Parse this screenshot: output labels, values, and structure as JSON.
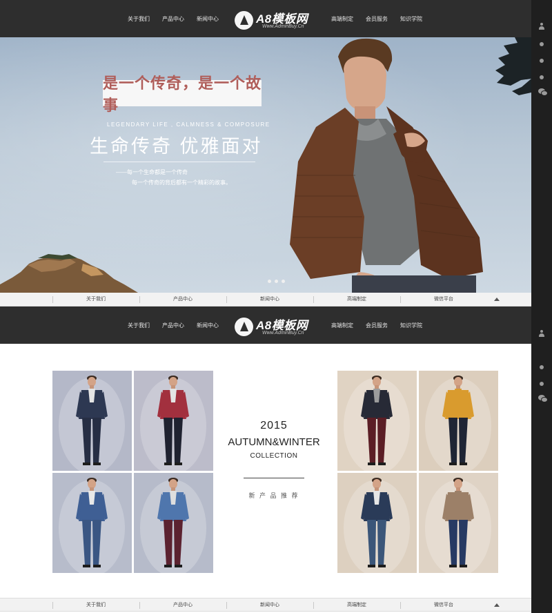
{
  "header": {
    "nav_left": [
      "关于我们",
      "产品中心",
      "新闻中心"
    ],
    "nav_right": [
      "高端制定",
      "会员服务",
      "知识学院"
    ],
    "logo_text": "A8模板网",
    "logo_url": "Www.AdminBuy.Cn"
  },
  "hero": {
    "headline": "是一个传奇，是一个故事",
    "tagline_en": "LEGENDARY LIFE , CALMNESS & COMPOSURE",
    "tagline_cn": "生命传奇 优雅面对",
    "sub1": "——每一个生命都是一个传奇",
    "sub2": "每一个传奇的背后都有一个精彩的故事。",
    "slide_count": 3
  },
  "subnav": {
    "items": [
      "关于我们",
      "产品中心",
      "新闻中心",
      "高端制定",
      "微信平台"
    ]
  },
  "collection": {
    "year": "2015",
    "season": "AUTUMN&WINTER",
    "label": "COLLECTION",
    "subtitle": "新 产 品 推 荐"
  },
  "products_left": [
    {
      "name": "navy-suit",
      "bg": "#b4b8c8",
      "jacket": "#2d3852",
      "pants": "#262e44",
      "shirt": "#e4e4e4"
    },
    {
      "name": "red-blazer",
      "bg": "#bcbcca",
      "jacket": "#a2303e",
      "pants": "#1f2230",
      "shirt": "#e4e4e4"
    },
    {
      "name": "blue-suit",
      "bg": "#b7bccb",
      "jacket": "#3f5f94",
      "pants": "#3a5683",
      "shirt": "#e8e8e8"
    },
    {
      "name": "blue-blazer",
      "bg": "#b6bbca",
      "jacket": "#4f76ad",
      "pants": "#5b2230",
      "shirt": "#dedede"
    }
  ],
  "products_right": [
    {
      "name": "bomber-jacket",
      "bg": "#e0d3c3",
      "jacket": "#272a36",
      "pants": "#5b1e25",
      "shirt": "#9c9c9c"
    },
    {
      "name": "mustard-sweater",
      "bg": "#dccebd",
      "jacket": "#d99b2e",
      "pants": "#1f2535",
      "shirt": "#d99b2e"
    },
    {
      "name": "check-shirt",
      "bg": "#ddd0c0",
      "jacket": "#2a3b58",
      "pants": "#3b5679",
      "shirt": "#e6e6e6"
    },
    {
      "name": "beige-sweater",
      "bg": "#dfd3c5",
      "jacket": "#9c8068",
      "pants": "#273a63",
      "shirt": "#9c8068"
    }
  ],
  "colors": {
    "header_bg": "#2e2e2e",
    "sidebar_bg": "#1f1f1f",
    "headline_red": "#b05e5a",
    "subbar_bg": "#f2f2f2"
  },
  "side_toolbar": {
    "icons_top": [
      "user-icon",
      "dot-icon",
      "dot-icon",
      "dot-icon",
      "wechat-icon"
    ],
    "icons_bottom": [
      "user-icon",
      "dot-icon",
      "dot-icon",
      "wechat-icon"
    ]
  }
}
